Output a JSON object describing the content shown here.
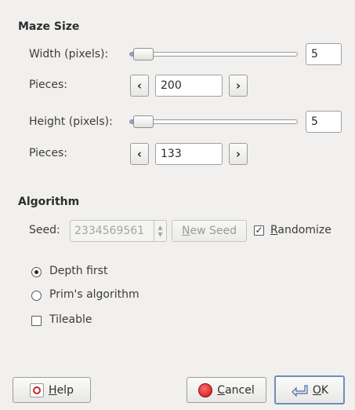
{
  "maze_size": {
    "title": "Maze Size",
    "width": {
      "label": "Width (pixels):",
      "value": "5",
      "slider_fraction": 0.02
    },
    "width_pieces": {
      "label": "Pieces:",
      "value": "200",
      "dec": "‹",
      "inc": "›"
    },
    "height": {
      "label": "Height (pixels):",
      "value": "5",
      "slider_fraction": 0.02
    },
    "height_pieces": {
      "label": "Pieces:",
      "value": "133",
      "dec": "‹",
      "inc": "›"
    }
  },
  "algorithm": {
    "title": "Algorithm",
    "seed_label": "Seed:",
    "seed_value": "2334569561",
    "new_seed_first": "N",
    "new_seed_rest": "ew Seed",
    "randomize_first": "R",
    "randomize_rest": "andomize",
    "randomize_checked": true,
    "options": [
      {
        "label": "Depth first",
        "selected": true
      },
      {
        "label": "Prim's algorithm",
        "selected": false
      }
    ],
    "tileable_label": "Tileable",
    "tileable_checked": false
  },
  "buttons": {
    "help_first": "H",
    "help_rest": "elp",
    "cancel_first": "C",
    "cancel_rest": "ancel",
    "ok_first": "O",
    "ok_rest": "K"
  },
  "colors": {
    "background": "#f1f0ee",
    "cancel_icon": "#d21f1f",
    "help_icon": "#c02828"
  }
}
